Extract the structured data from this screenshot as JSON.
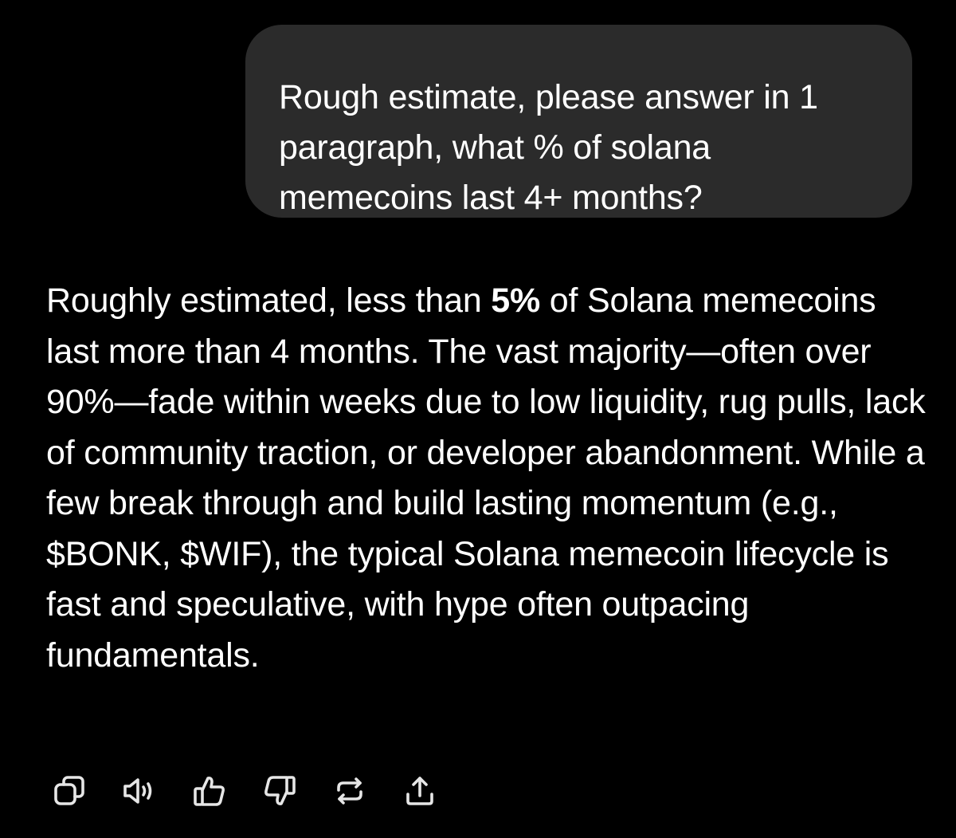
{
  "user_message": {
    "text": "Rough estimate, please answer in 1 paragraph, what % of solana memecoins last 4+ months?"
  },
  "assistant_message": {
    "text_before_bold": "Roughly estimated, less than ",
    "bold": "5%",
    "text_after_bold": " of Solana memecoins last more than 4 months. The vast majority—often over 90%—fade within weeks due to low liquidity, rug pulls, lack of community traction, or developer abandonment. While a few break through and build lasting momentum (e.g., $BONK, $WIF), the typical Solana memecoin lifecycle is fast and speculative, with hype often outpacing fundamentals."
  },
  "actions": [
    {
      "icon": "copy-icon"
    },
    {
      "icon": "speaker-icon"
    },
    {
      "icon": "thumbs-up-icon"
    },
    {
      "icon": "thumbs-down-icon"
    },
    {
      "icon": "regenerate-icon"
    },
    {
      "icon": "share-icon"
    }
  ],
  "colors": {
    "background": "#000000",
    "bubble": "#2b2b2b",
    "text": "#ffffff",
    "icon": "#e6e6e6"
  }
}
